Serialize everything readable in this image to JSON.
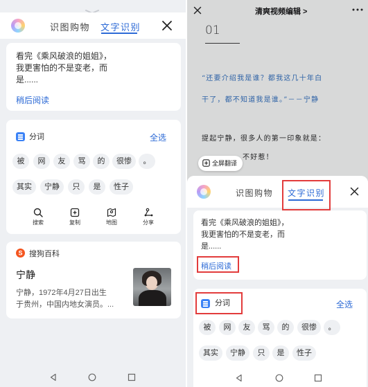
{
  "left": {
    "tabs": {
      "shop": "识图购物",
      "ocr": "文字识别"
    },
    "ocr_text": {
      "line1": "看完《乘风破浪的姐姐》，",
      "line2": "我更害怕的不是变老，而",
      "line3": "是......"
    },
    "read_later": "稍后阅读",
    "segment": {
      "title": "分词",
      "select_all": "全选",
      "row1": [
        "被",
        "网",
        "友",
        "骂",
        "的",
        "很惨",
        "。"
      ],
      "row2": [
        "其实",
        "宁静",
        "只",
        "是",
        "性子"
      ]
    },
    "actions": {
      "search": "搜索",
      "copy": "复制",
      "map": "地图",
      "share": "分享"
    },
    "baike": {
      "source": "搜狗百科",
      "name": "宁静",
      "desc_line1": "宁静，1972年4月27日出生",
      "desc_line2": "于贵州，中国内地女演员。..."
    }
  },
  "right": {
    "top_title": "清爽视频编辑 >",
    "doc": {
      "number": "01",
      "quote_line1": "“还要介绍我是谁？都我这几十年白",
      "quote_line2": "干了，都不知道我是谁。”－－宁静",
      "body_line1": "提起宁静，很多人的第一印象就是：",
      "body_line2": "不好惹！"
    },
    "fullscreen_translate": "全屏翻译",
    "tabs": {
      "shop": "识图购物",
      "ocr": "文字识别"
    },
    "ocr_text": {
      "line1": "看完《乘风破浪的姐姐》，",
      "line2": "我更害怕的不是变老，而",
      "line3": "是......"
    },
    "read_later": "稍后阅读",
    "segment": {
      "title": "分词",
      "select_all": "全选",
      "row1": [
        "被",
        "网",
        "友",
        "骂",
        "的",
        "很惨",
        "。"
      ],
      "row2": [
        "其实",
        "宁静",
        "只",
        "是",
        "性子"
      ]
    }
  },
  "colors": {
    "accent": "#2c6ad6",
    "highlight_box": "#e23b3b"
  },
  "icons": [
    "assistant-orb-icon",
    "close-icon",
    "segment-icon",
    "search-icon",
    "copy-icon",
    "map-icon",
    "share-icon",
    "sogou-baike-icon",
    "more-icon",
    "fullscreen-icon",
    "back-nav-icon",
    "home-nav-icon",
    "recents-nav-icon"
  ]
}
